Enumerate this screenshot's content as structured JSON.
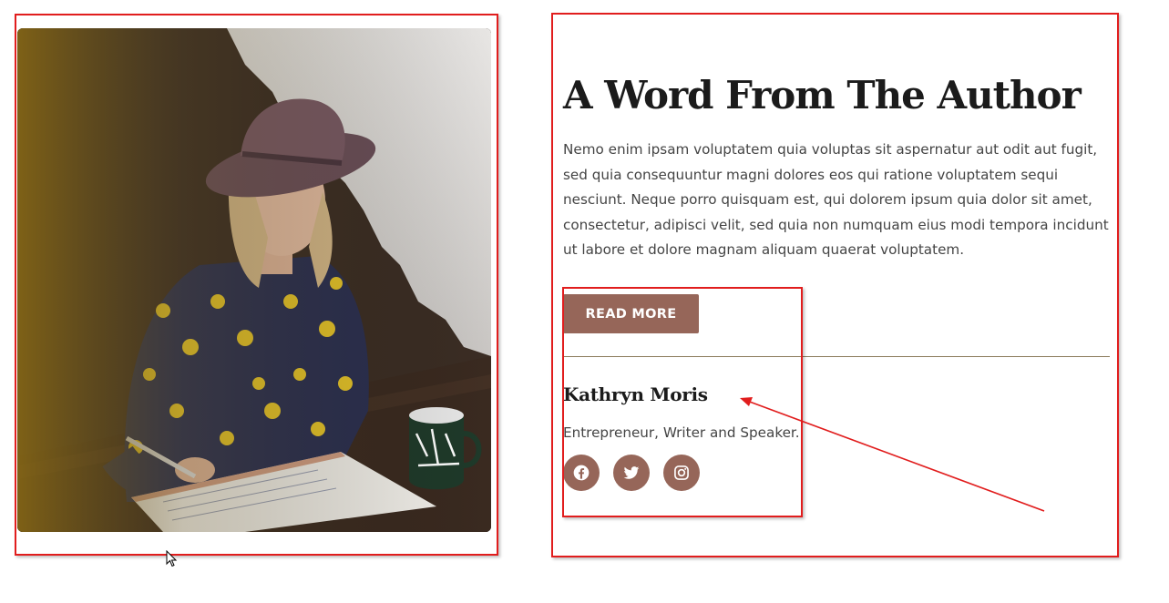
{
  "section": {
    "title": "A Word From The Author",
    "body": "Nemo enim ipsam voluptatem quia voluptas sit aspernatur aut odit aut fugit, sed quia consequuntur magni dolores eos qui ratione voluptatem sequi nesciunt. Neque porro quisquam est, qui dolorem ipsum quia dolor sit amet, consectetur, adipisci velit, sed quia non numquam eius modi tempora incidunt ut labore et dolore magnam aliquam quaerat voluptatem.",
    "button_label": "READ MORE",
    "author_name": "Kathryn Moris",
    "author_role": "Entrepreneur, Writer and Speaker.",
    "social_icons": [
      "facebook-icon",
      "twitter-icon",
      "instagram-icon"
    ]
  },
  "photo": {
    "icon": "author-photo"
  },
  "colors": {
    "accent": "#966659",
    "annotation": "#e11d1d",
    "title": "#1b1b1b",
    "body": "#444444"
  }
}
